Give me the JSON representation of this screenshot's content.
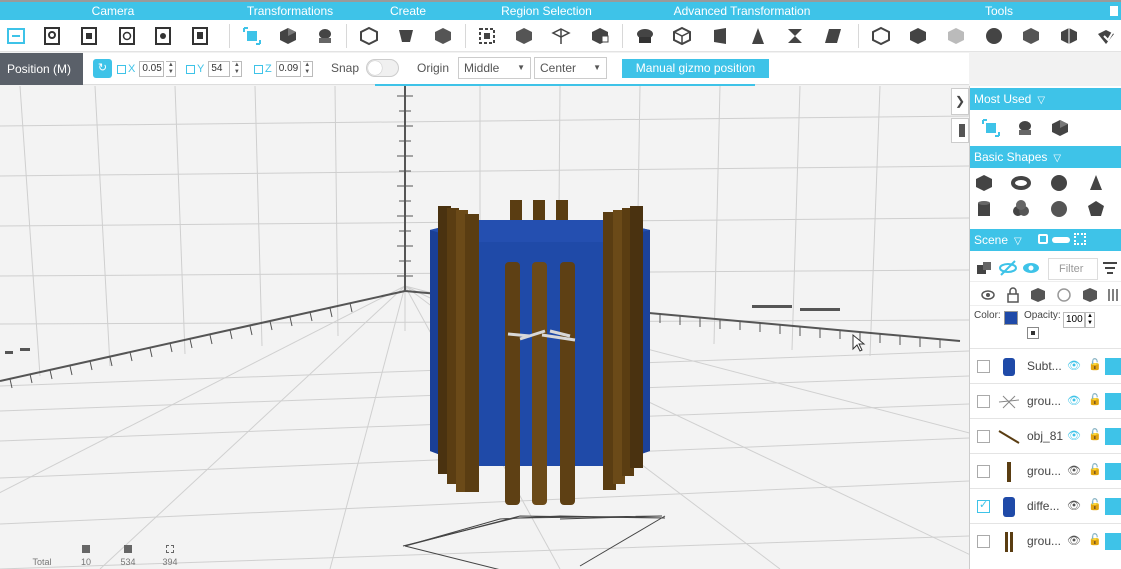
{
  "menubar": {
    "groups": [
      "Camera",
      "Transformations",
      "Create",
      "Region Selection",
      "Advanced Transformation",
      "Tools"
    ]
  },
  "posbar": {
    "mode_label": "Position (M)",
    "x_label": "X",
    "x_value": "0.05",
    "y_label": "Y",
    "y_value": "54",
    "z_label": "Z",
    "z_value": "0.09",
    "snap_label": "Snap",
    "origin_label": "Origin",
    "origin_vertical": "Middle",
    "origin_horizontal": "Center",
    "gizmo_button": "Manual gizmo position"
  },
  "stats": {
    "total_label": "Total",
    "a_value": "10",
    "b_value": "534",
    "c_value": "394"
  },
  "panel": {
    "most_used": "Most Used",
    "basic_shapes": "Basic Shapes",
    "scene": "Scene",
    "filter_placeholder": "Filter",
    "color_label": "Color:",
    "opacity_label": "Opacity:",
    "opacity_value": "100",
    "rows": [
      {
        "name": "Subt...",
        "checked": false
      },
      {
        "name": "grou...",
        "checked": false
      },
      {
        "name": "obj_81",
        "checked": false
      },
      {
        "name": "grou...",
        "checked": false
      },
      {
        "name": "diffe...",
        "checked": true
      },
      {
        "name": "grou...",
        "checked": false
      }
    ]
  },
  "colors": {
    "accent": "#3ec3e8",
    "object_blue": "#1f4aa8",
    "post_brown": "#5a3d12"
  }
}
